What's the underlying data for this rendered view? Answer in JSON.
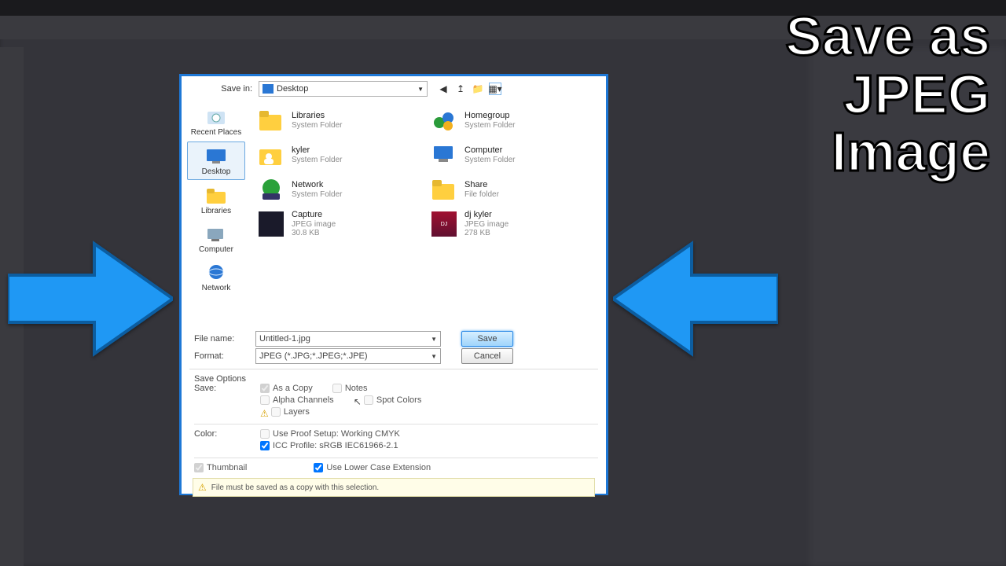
{
  "overlay": {
    "title": "Save as\nJPEG\nImage"
  },
  "dialog": {
    "save_in_label": "Save in:",
    "save_in_value": "Desktop",
    "places": [
      {
        "key": "recent",
        "label": "Recent Places"
      },
      {
        "key": "desktop",
        "label": "Desktop"
      },
      {
        "key": "libraries",
        "label": "Libraries"
      },
      {
        "key": "computer",
        "label": "Computer"
      },
      {
        "key": "network",
        "label": "Network"
      }
    ],
    "selected_place": "desktop",
    "files": [
      {
        "title": "Libraries",
        "sub": "System Folder",
        "icon": "libraries"
      },
      {
        "title": "Homegroup",
        "sub": "System Folder",
        "icon": "homegroup"
      },
      {
        "title": "kyler",
        "sub": "System Folder",
        "icon": "user"
      },
      {
        "title": "Computer",
        "sub": "System Folder",
        "icon": "computer"
      },
      {
        "title": "Network",
        "sub": "System Folder",
        "icon": "network"
      },
      {
        "title": "Share",
        "sub": "File folder",
        "icon": "share"
      },
      {
        "title": "Capture",
        "sub": "JPEG image",
        "sub2": "30.8 KB",
        "icon": "img-dark"
      },
      {
        "title": "dj kyler",
        "sub": "JPEG image",
        "sub2": "278 KB",
        "icon": "img-red"
      }
    ],
    "file_name_label": "File name:",
    "file_name_value": "Untitled-1.jpg",
    "format_label": "Format:",
    "format_value": "JPEG (*.JPG;*.JPEG;*.JPE)",
    "save_btn": "Save",
    "cancel_btn": "Cancel",
    "save_options_title": "Save Options",
    "save_label": "Save:",
    "as_a_copy": "As a Copy",
    "notes": "Notes",
    "alpha": "Alpha Channels",
    "spot": "Spot Colors",
    "layers": "Layers",
    "color_label": "Color:",
    "proof": "Use Proof Setup:  Working CMYK",
    "icc": "ICC Profile:  sRGB IEC61966-2.1",
    "thumb": "Thumbnail",
    "lowercase": "Use Lower Case Extension",
    "footnote": "File must be saved as a copy with this selection."
  }
}
